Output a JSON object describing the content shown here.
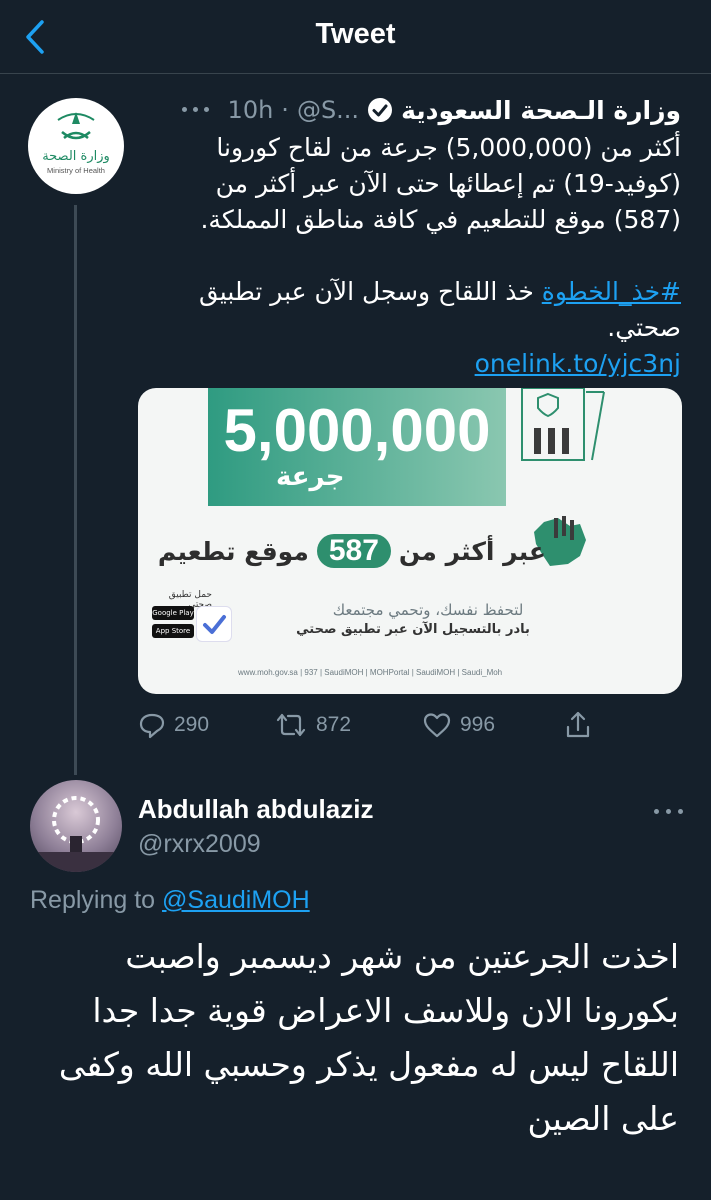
{
  "header": {
    "title": "Tweet"
  },
  "tweet": {
    "author_name": "وزارة الـصحة السعودية",
    "author_handle": "@S...",
    "separator": "·",
    "time": "10h",
    "logo_text_ar": "وزارة الصحة",
    "logo_text_en": "Ministry of Health",
    "text_lines": [
      "أكثر من (5,000,000) جرعة من لقاح كورونا",
      "(كوفيد-19) تم إعطائها حتى الآن عبر أكثر من",
      "(587) موقع للتطعيم في كافة مناطق المملكة."
    ],
    "hashtag": "#خذ_الخطوة",
    "cta_text": " خذ اللقاح وسجل الآن عبر تطبيق",
    "cta_line2": "صحتي.",
    "link": "onelink.to/yjc3nj",
    "media": {
      "big_number": "5,000,000",
      "doses_label": "جرعة",
      "sites_prefix": "عبر أكثر من",
      "sites_number": "587",
      "sites_suffix": "موقع تطعيم",
      "protect_line": "لتحفظ نفسك، وتحمي مجتمعك",
      "register_line": "بادر بالتسجيل الآن عبر تطبيق صحتي",
      "app_label": "حمل تطبيق صحتي",
      "store1": "Google Play",
      "store2": "App Store",
      "footer": "www.moh.gov.sa  |  937  |  SaudiMOH  |  MOHPortal  |  SaudiMOH  |  Saudi_Moh"
    },
    "stats": {
      "replies": "290",
      "retweets": "872",
      "likes": "996"
    }
  },
  "reply": {
    "author_name": "Abdullah abdulaziz",
    "author_handle": "@rxrx2009",
    "replying_to_label": "Replying to",
    "replying_to_handle": "@SaudiMOH",
    "text_lines": [
      "اخذت الجرعتين  من شهر ديسمبر واصبت",
      "بكورونا  الان وللاسف الاعراض قوية جدا جدا",
      "اللقاح ليس له مفعول يذكر وحسبي الله وكفى",
      "على الصين"
    ]
  },
  "colors": {
    "background": "#15202b",
    "accent": "#1da1f2",
    "muted": "#8899a6",
    "divider": "#38444d"
  }
}
